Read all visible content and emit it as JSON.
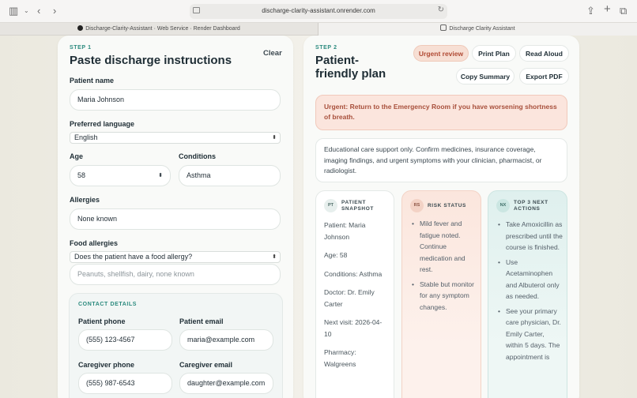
{
  "browser": {
    "url": "discharge-clarity-assistant.onrender.com",
    "tabs": [
      {
        "label": "Discharge-Clarity-Assistant · Web Service · Render Dashboard"
      },
      {
        "label": "Discharge Clarity Assistant"
      }
    ]
  },
  "left": {
    "step": "STEP 1",
    "title": "Paste discharge instructions",
    "clear": "Clear",
    "patient_name_label": "Patient name",
    "patient_name_value": "Maria Johnson",
    "language_label": "Preferred language",
    "language_value": "English",
    "age_label": "Age",
    "age_value": "58",
    "conditions_label": "Conditions",
    "conditions_value": "Asthma",
    "allergies_label": "Allergies",
    "allergies_value": "None known",
    "food_label": "Food allergies",
    "food_select": "Does the patient have a food allergy?",
    "food_placeholder": "Peanuts, shellfish, dairy, none known",
    "contact": {
      "heading": "CONTACT DETAILS",
      "patient_phone_label": "Patient phone",
      "patient_phone_value": "(555) 123-4567",
      "patient_email_label": "Patient email",
      "patient_email_value": "maria@example.com",
      "caregiver_phone_label": "Caregiver phone",
      "caregiver_phone_value": "(555) 987-6543",
      "caregiver_email_label": "Caregiver email",
      "caregiver_email_value": "daughter@example.com"
    }
  },
  "right": {
    "step": "STEP 2",
    "title_line1": "Patient-",
    "title_line2": "friendly plan",
    "buttons": {
      "urgent": "Urgent review",
      "print": "Print Plan",
      "read": "Read Aloud",
      "copy": "Copy Summary",
      "export": "Export PDF"
    },
    "alert": "Urgent: Return to the Emergency Room if you have worsening shortness of breath.",
    "note": "Educational care support only. Confirm medicines, insurance coverage, imaging findings, and urgent symptoms with your clinician, pharmacist, or radiologist.",
    "snapshot": {
      "badge": "PT",
      "title_line1": "PATIENT",
      "title_line2": "SNAPSHOT",
      "items": [
        "Patient: Maria Johnson",
        "Age: 58",
        "Conditions: Asthma",
        "Doctor: Dr. Emily Carter",
        "Next visit: 2026-04-10",
        "Pharmacy: Walgreens"
      ]
    },
    "risk": {
      "badge": "RS",
      "title": "RISK STATUS",
      "items": [
        "Mild fever and fatigue noted. Continue medication and rest.",
        "Stable but monitor for any symptom changes."
      ]
    },
    "actions": {
      "badge": "NX",
      "title_line1": "TOP 3 NEXT",
      "title_line2": "ACTIONS",
      "items": [
        "Take Amoxicillin as prescribed until the course is finished.",
        "Use Acetaminophen and Albuterol only as needed.",
        "See your primary care physician, Dr. Emily Carter, within 5 days. The appointment is"
      ]
    }
  }
}
